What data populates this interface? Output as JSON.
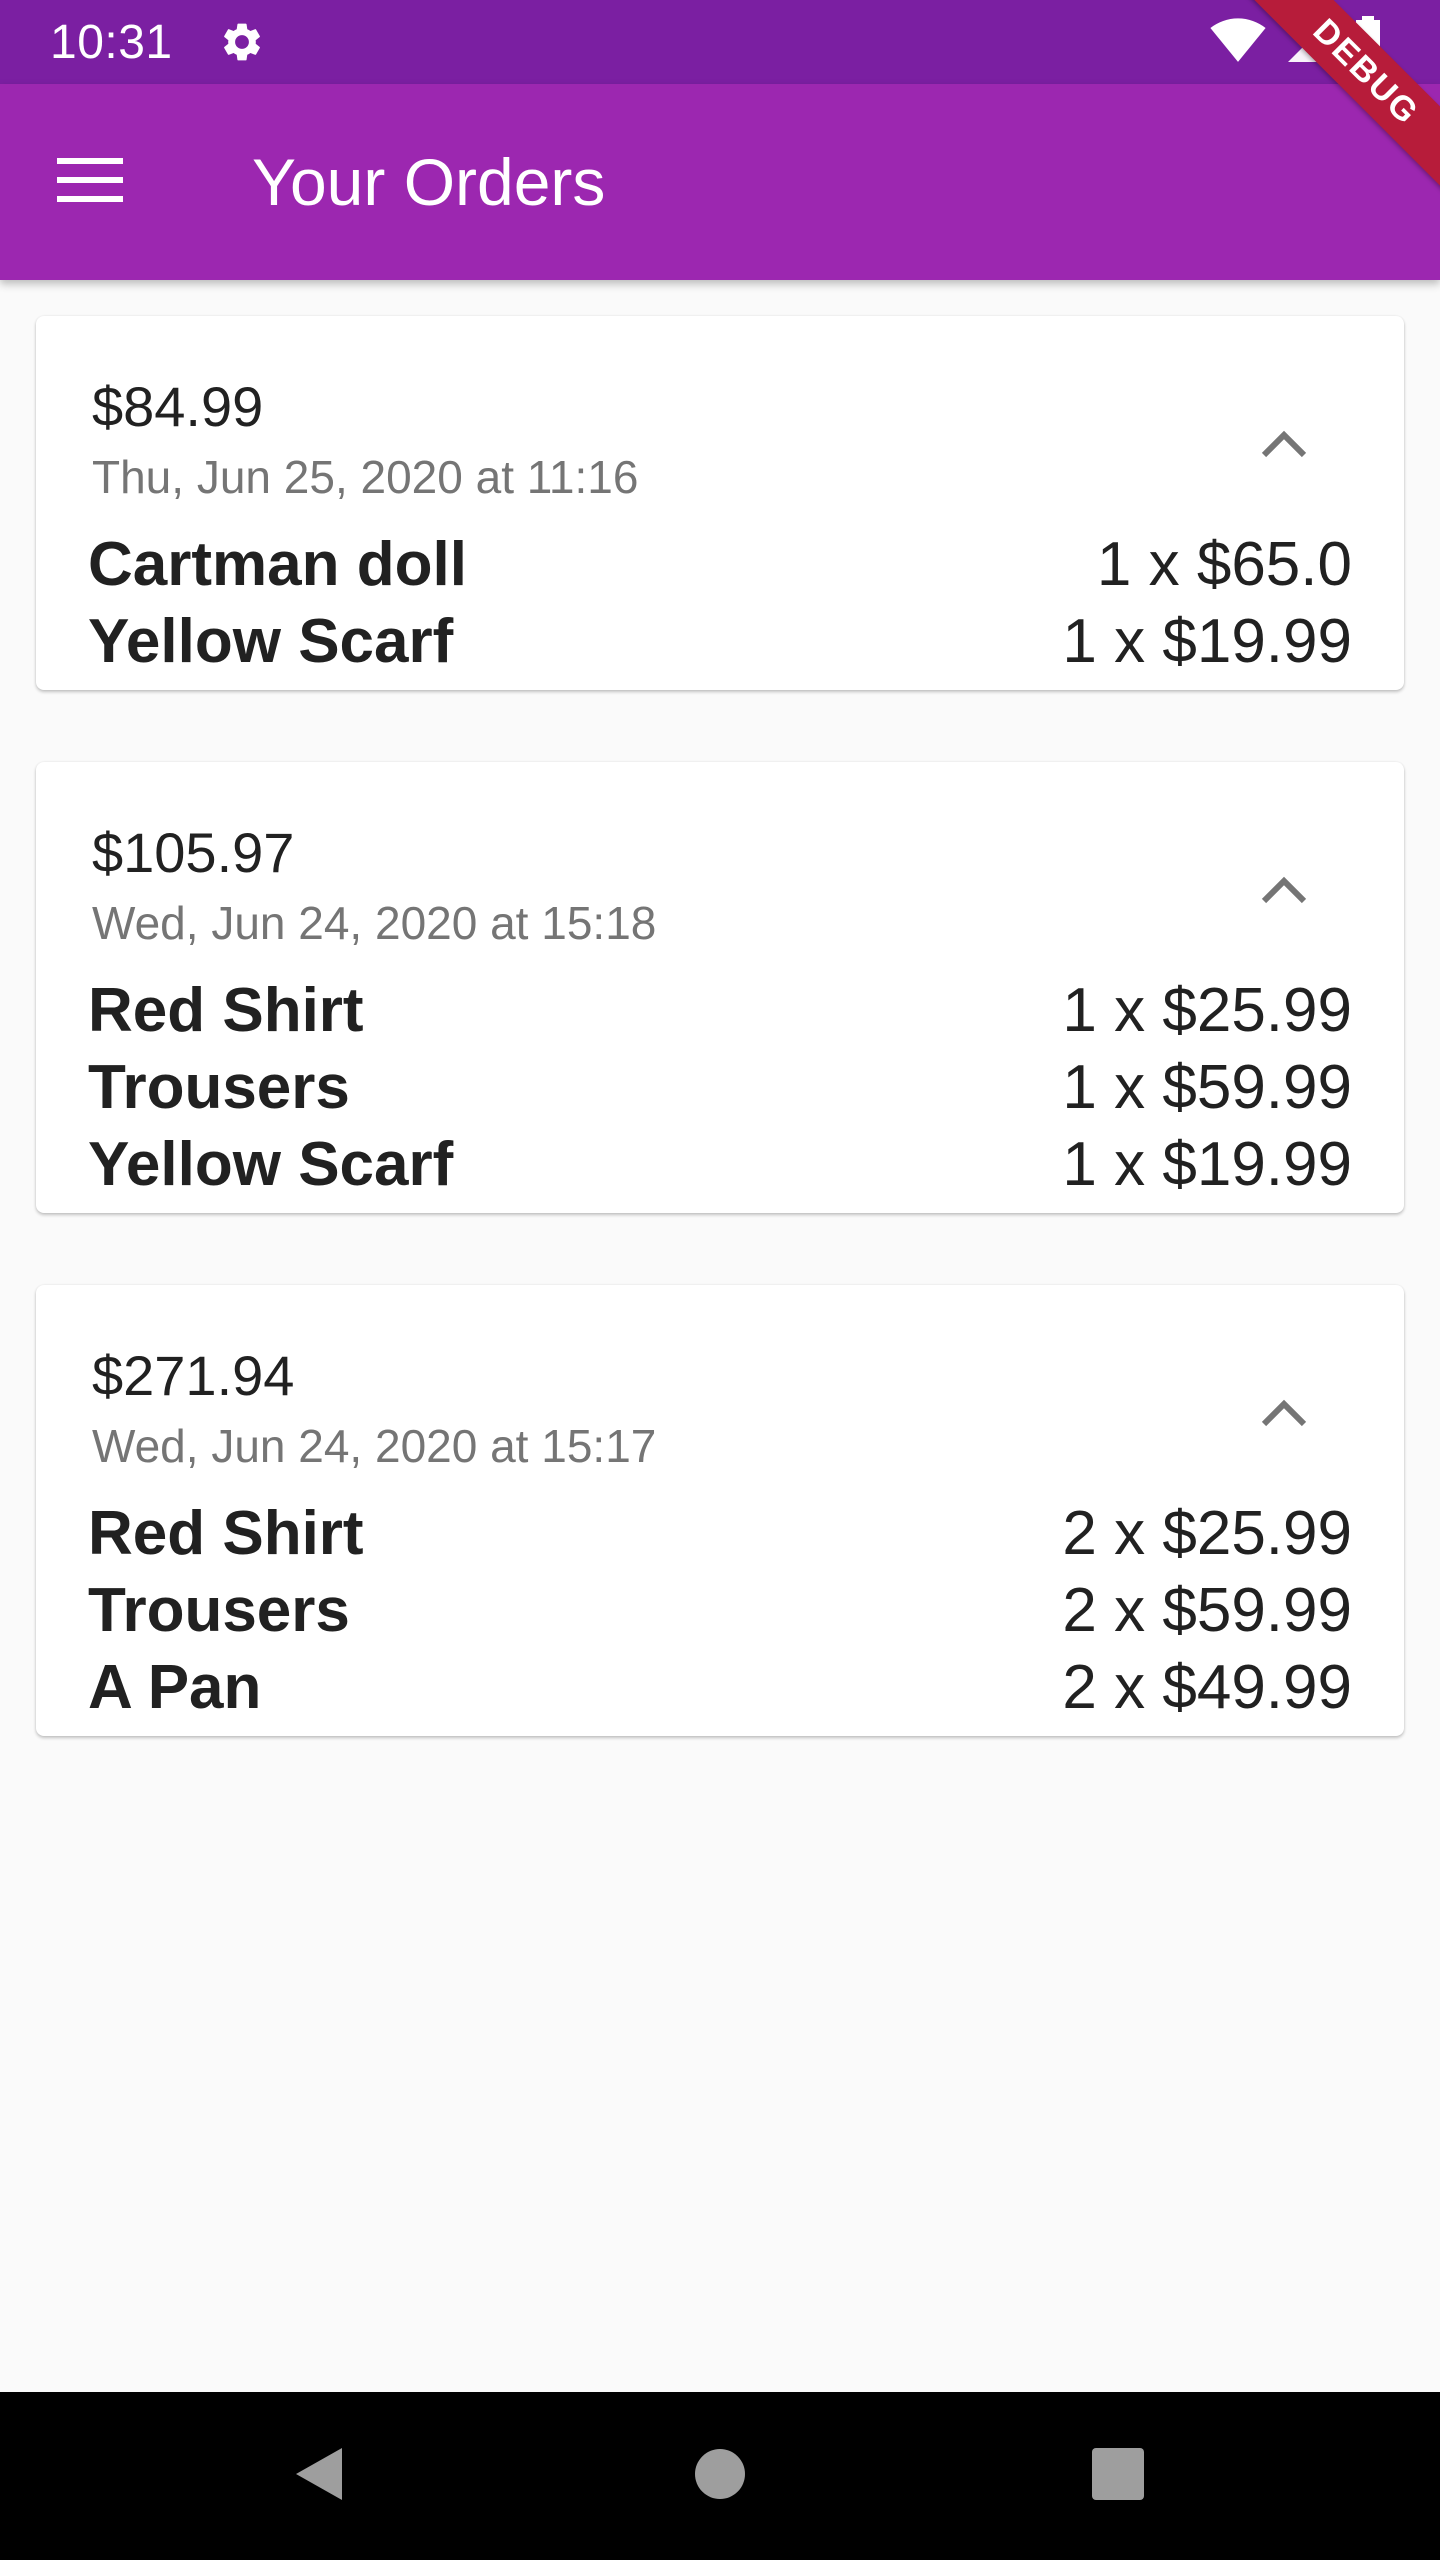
{
  "status_bar": {
    "time": "10:31",
    "icons": [
      "gear-icon",
      "wifi-icon",
      "cellular-signal-icon",
      "battery-icon"
    ]
  },
  "debug_banner": {
    "label": "DEBUG"
  },
  "app_bar": {
    "title": "Your Orders",
    "menu_icon": "menu-icon",
    "color": "#9c27b0",
    "status_color": "#7b1fa2"
  },
  "orders": [
    {
      "total": "$84.99",
      "date": "Thu, Jun 25, 2020 at 11:16",
      "expand_icon": "chevron-up-icon",
      "items": [
        {
          "name": "Cartman doll",
          "qty": "1 x $65.0"
        },
        {
          "name": "Yellow Scarf",
          "qty": "1 x $19.99"
        }
      ]
    },
    {
      "total": "$105.97",
      "date": "Wed, Jun 24, 2020 at 15:18",
      "expand_icon": "chevron-up-icon",
      "items": [
        {
          "name": "Red Shirt",
          "qty": "1 x $25.99"
        },
        {
          "name": "Trousers",
          "qty": "1 x $59.99"
        },
        {
          "name": "Yellow Scarf",
          "qty": "1 x $19.99"
        }
      ]
    },
    {
      "total": "$271.94",
      "date": "Wed, Jun 24, 2020 at 15:17",
      "expand_icon": "chevron-up-icon",
      "items": [
        {
          "name": "Red Shirt",
          "qty": "2 x $25.99"
        },
        {
          "name": "Trousers",
          "qty": "2 x $59.99"
        },
        {
          "name": "A Pan",
          "qty": "2 x $49.99"
        }
      ]
    }
  ],
  "nav_bar": {
    "icons": [
      "back-icon",
      "home-icon",
      "recents-icon"
    ]
  }
}
